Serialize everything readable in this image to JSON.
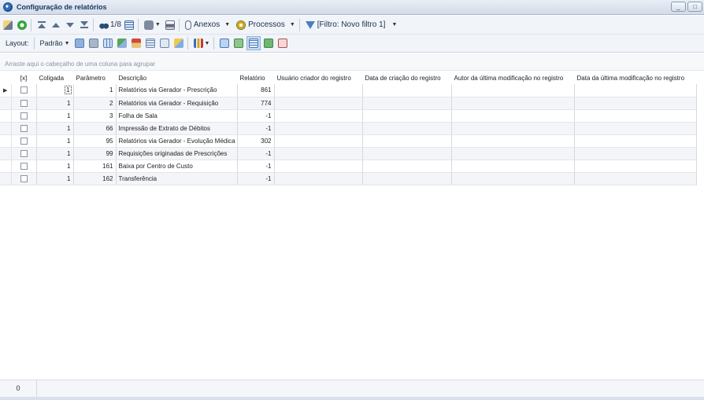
{
  "window": {
    "title": "Configuração de relatórios",
    "minimize": "_",
    "maximize": "□"
  },
  "toolbar": {
    "record_position": "1/8",
    "anexos": "Anexos",
    "processos": "Processos",
    "filter": "[Filtro: Novo filtro 1]"
  },
  "layout_bar": {
    "label": "Layout:",
    "selected": "Padrão"
  },
  "group_panel": {
    "hint": "Arraste aqui o cabeçalho de uma coluna para agrupar"
  },
  "grid": {
    "columns": [
      "[x]",
      "Coligada",
      "Parâmetro",
      "Descrição",
      "Relatório",
      "Usuário criador do registro",
      "Data de criação do registro",
      "Autor da última modificação no registro",
      "Data da última modificação no registro"
    ],
    "rows": [
      {
        "coligada": "1",
        "parametro": "1",
        "descricao": "Relatórios via Gerador - Prescrição",
        "relatorio": "861"
      },
      {
        "coligada": "1",
        "parametro": "2",
        "descricao": "Relatórios via Gerador - Requisição",
        "relatorio": "774"
      },
      {
        "coligada": "1",
        "parametro": "3",
        "descricao": "Folha de Sala",
        "relatorio": "-1"
      },
      {
        "coligada": "1",
        "parametro": "66",
        "descricao": "Impressão de Extrato de Débitos",
        "relatorio": "-1"
      },
      {
        "coligada": "1",
        "parametro": "95",
        "descricao": "Relatórios via Gerador - Evolução Médica",
        "relatorio": "302"
      },
      {
        "coligada": "1",
        "parametro": "99",
        "descricao": "Requisições originadas de Prescrições",
        "relatorio": "-1"
      },
      {
        "coligada": "1",
        "parametro": "161",
        "descricao": "Baixa por Centro de Custo",
        "relatorio": "-1"
      },
      {
        "coligada": "1",
        "parametro": "162",
        "descricao": "Transferência",
        "relatorio": "-1"
      }
    ]
  },
  "footer": {
    "count": "0"
  }
}
